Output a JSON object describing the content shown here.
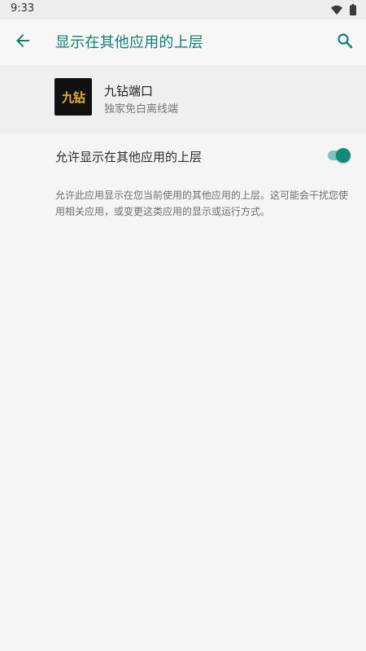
{
  "status_bar": {
    "time": "9:33",
    "icons": [
      "wifi-icon",
      "battery-icon"
    ]
  },
  "app_bar": {
    "title": "显示在其他应用的上层",
    "back_icon": "arrow-left-icon",
    "search_icon": "search-icon",
    "accent_color": "#0f7f73"
  },
  "app_info": {
    "icon_text": "九钻",
    "name": "九钻端口",
    "subtitle": "独家免白离线端"
  },
  "setting": {
    "label": "允许显示在其他应用的上层",
    "enabled": true
  },
  "description": "允许此应用显示在您当前使用的其他应用的上层。这可能会干扰您使用相关应用，或变更这类应用的显示或运行方式。"
}
